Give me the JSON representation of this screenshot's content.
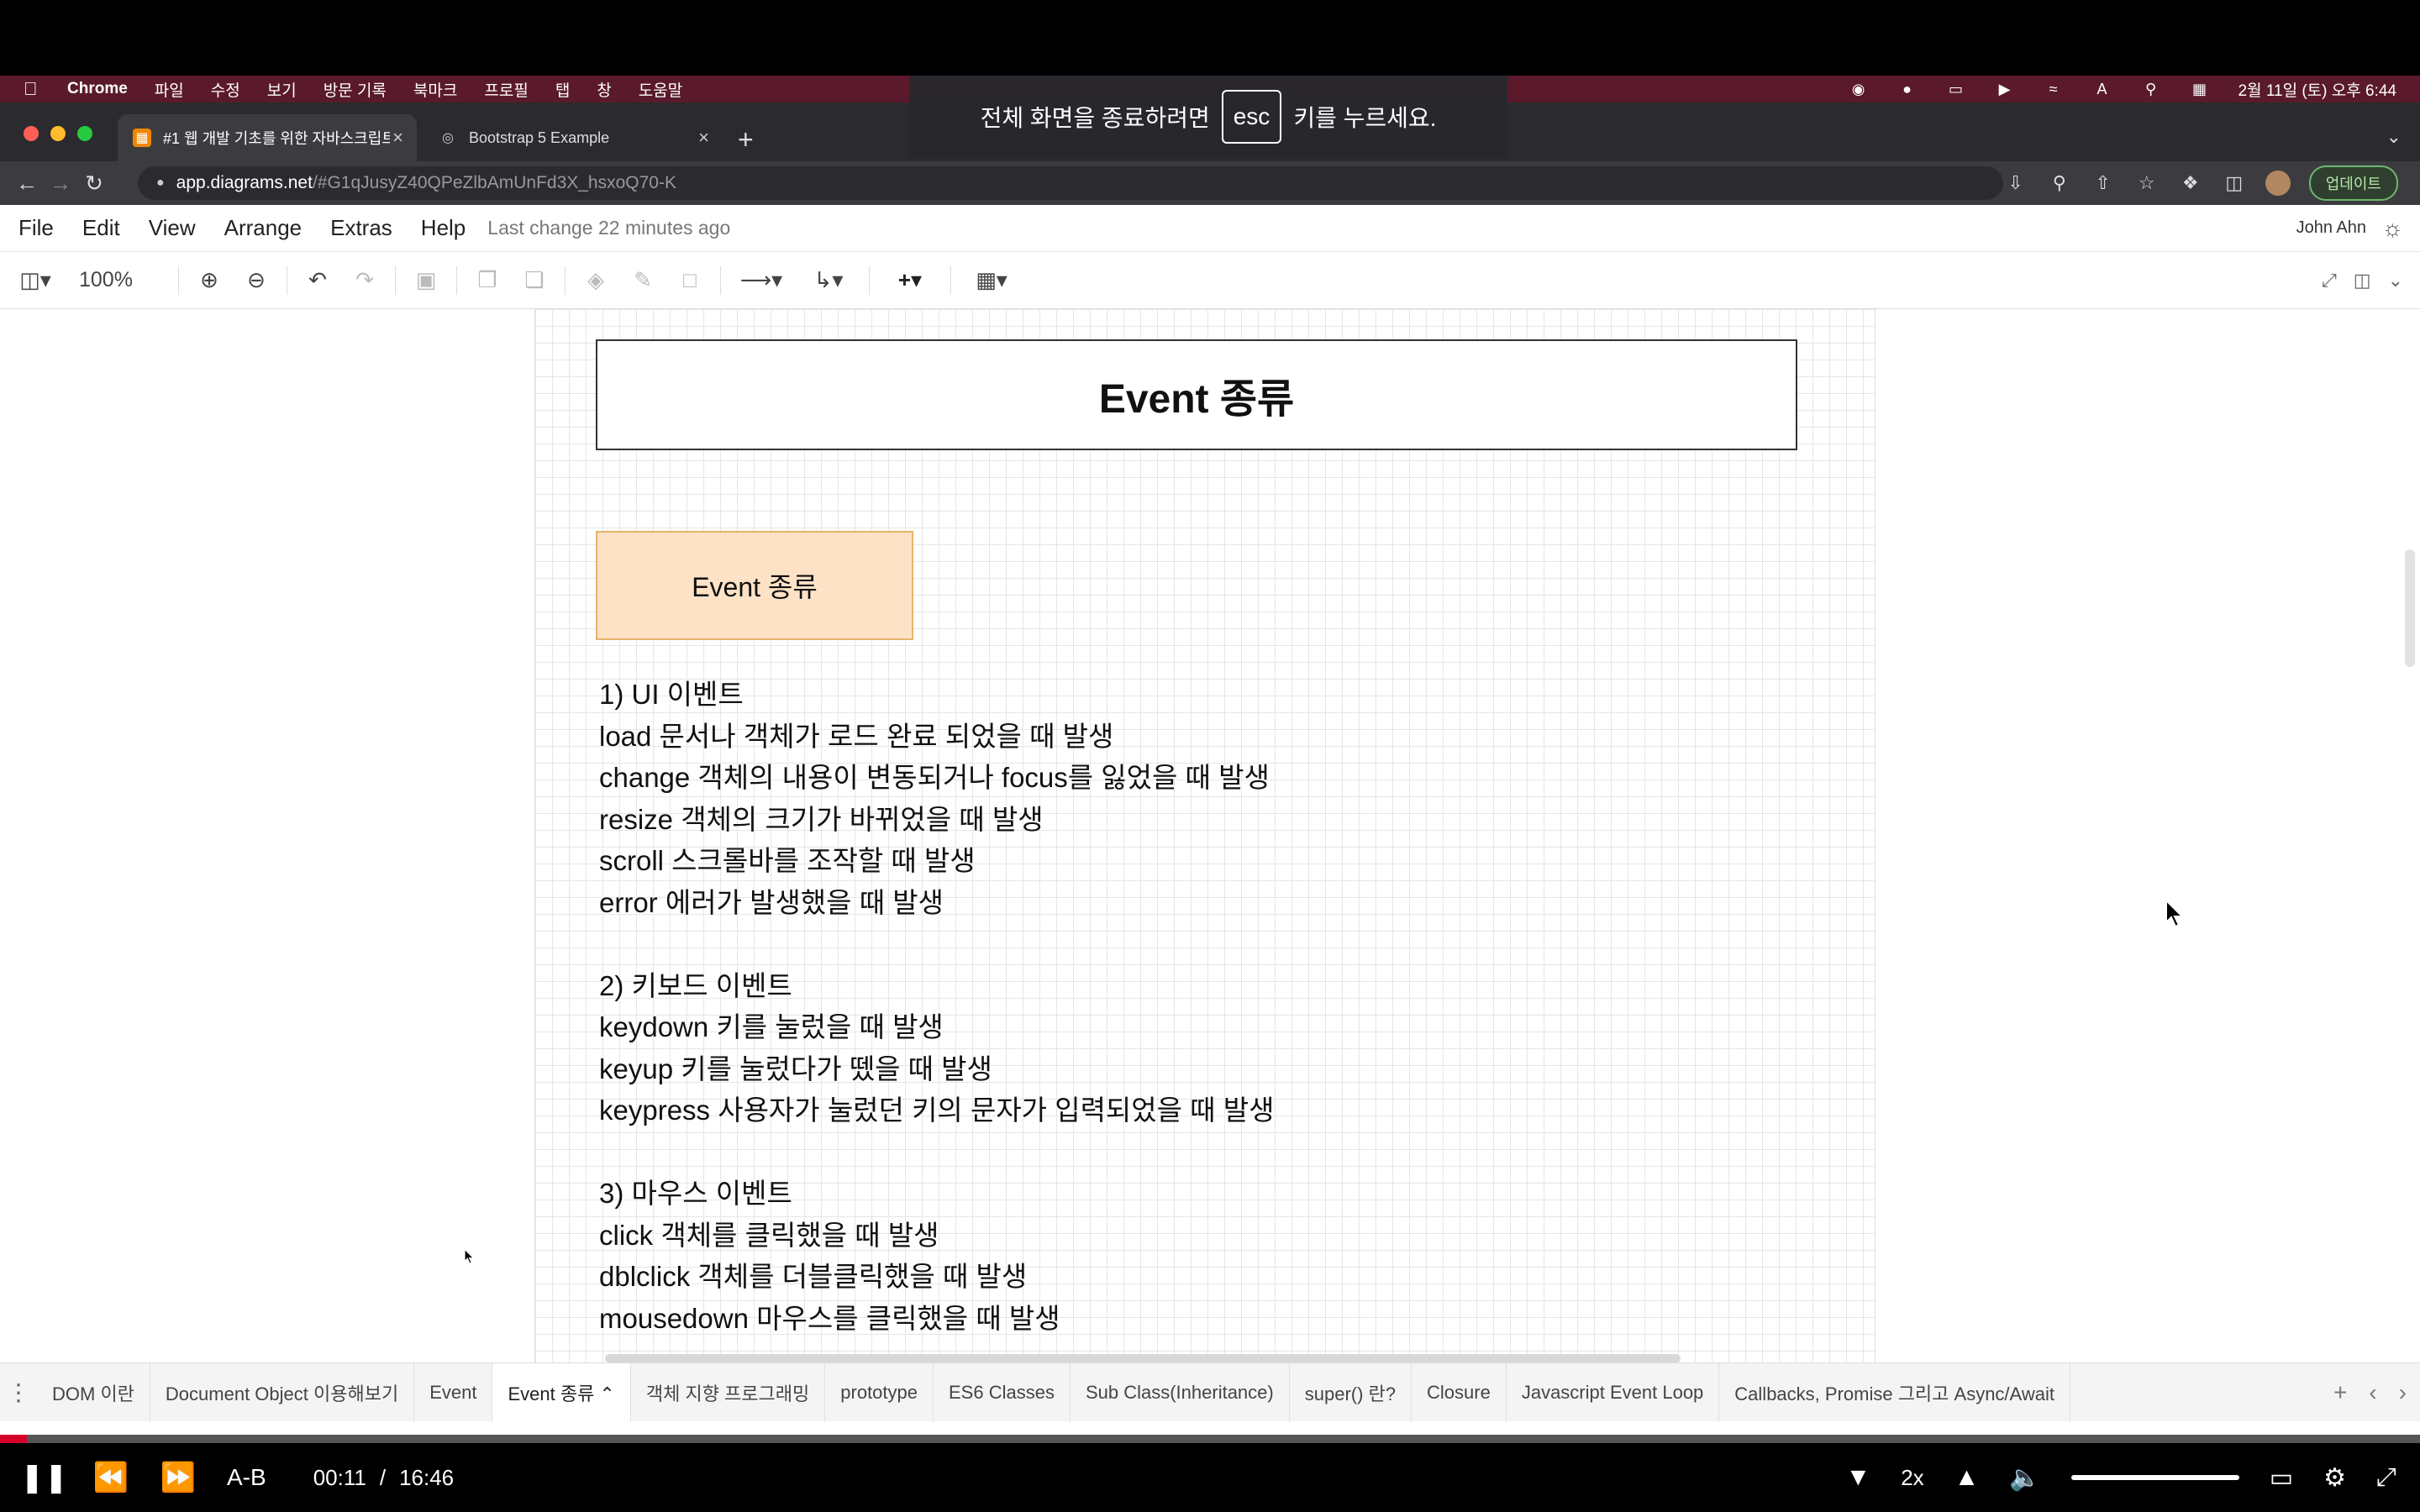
{
  "macos_menubar": {
    "app": "Chrome",
    "items": [
      "파일",
      "수정",
      "보기",
      "방문 기록",
      "북마크",
      "프로필",
      "탭",
      "창",
      "도움말"
    ],
    "input_indicator": "A",
    "clock": "2월 11일 (토) 오후 6:44"
  },
  "fullscreen_notice": {
    "before": "전체 화면을 종료하려면",
    "key": "esc",
    "after": "키를 누르세요."
  },
  "browser": {
    "tabs": [
      {
        "title": "#1 웹 개발 기초를 위한 자바스크립트",
        "active": true
      },
      {
        "title": "Bootstrap 5 Example",
        "active": false
      }
    ],
    "url_host": "app.diagrams.net",
    "url_rest": "/#G1qJusyZ40QPeZlbAmUnFd3X_hsxoQ70-K",
    "update_label": "업데이트"
  },
  "drawio": {
    "menu": [
      "File",
      "Edit",
      "View",
      "Arrange",
      "Extras",
      "Help"
    ],
    "last_change": "Last change 22 minutes ago",
    "user": "John Ahn",
    "zoom": "100%",
    "title_box": "Event 종류",
    "event_box": "Event 종류",
    "text_lines": [
      "1) UI 이벤트",
      "load 문서나 객체가 로드 완료 되었을 때 발생",
      "change 객체의 내용이 변동되거나 focus를 잃었을 때 발생",
      "resize 객체의 크기가 바뀌었을 때 발생",
      "scroll 스크롤바를 조작할 때 발생",
      "error 에러가 발생했을 때 발생",
      "",
      "2) 키보드 이벤트",
      "keydown 키를 눌렀을 때 발생",
      "keyup 키를 눌렀다가 뗐을 때 발생",
      "keypress 사용자가 눌렀던 키의 문자가 입력되었을 때 발생",
      "",
      "3) 마우스 이벤트",
      "click 객체를 클릭했을 때 발생",
      "dblclick 객체를 더블클릭했을 때 발생",
      "mousedown 마우스를 클릭했을 때 발생"
    ],
    "page_tabs": [
      {
        "label": "DOM 이란",
        "active": false
      },
      {
        "label": "Document Object 이용해보기",
        "active": false
      },
      {
        "label": "Event",
        "active": false
      },
      {
        "label": "Event 종류 ⌃",
        "active": true
      },
      {
        "label": "객체 지향 프로그래밍",
        "active": false
      },
      {
        "label": "prototype",
        "active": false
      },
      {
        "label": "ES6 Classes",
        "active": false
      },
      {
        "label": "Sub Class(Inheritance)",
        "active": false
      },
      {
        "label": "super() 란?",
        "active": false
      },
      {
        "label": "Closure",
        "active": false
      },
      {
        "label": "Javascript Event Loop",
        "active": false
      },
      {
        "label": "Callbacks, Promise 그리고 Async/Await",
        "active": false
      }
    ]
  },
  "player": {
    "ab_label": "A-B",
    "current_time": "00:11",
    "separator": "/",
    "duration": "16:46",
    "speed": "2x",
    "progress_fraction": 0.011
  },
  "colors": {
    "menubar_bg": "#5a1a2c",
    "event_box_fill": "#fde2c6",
    "event_box_stroke": "#e6b46a",
    "progress": "#d4002a"
  }
}
